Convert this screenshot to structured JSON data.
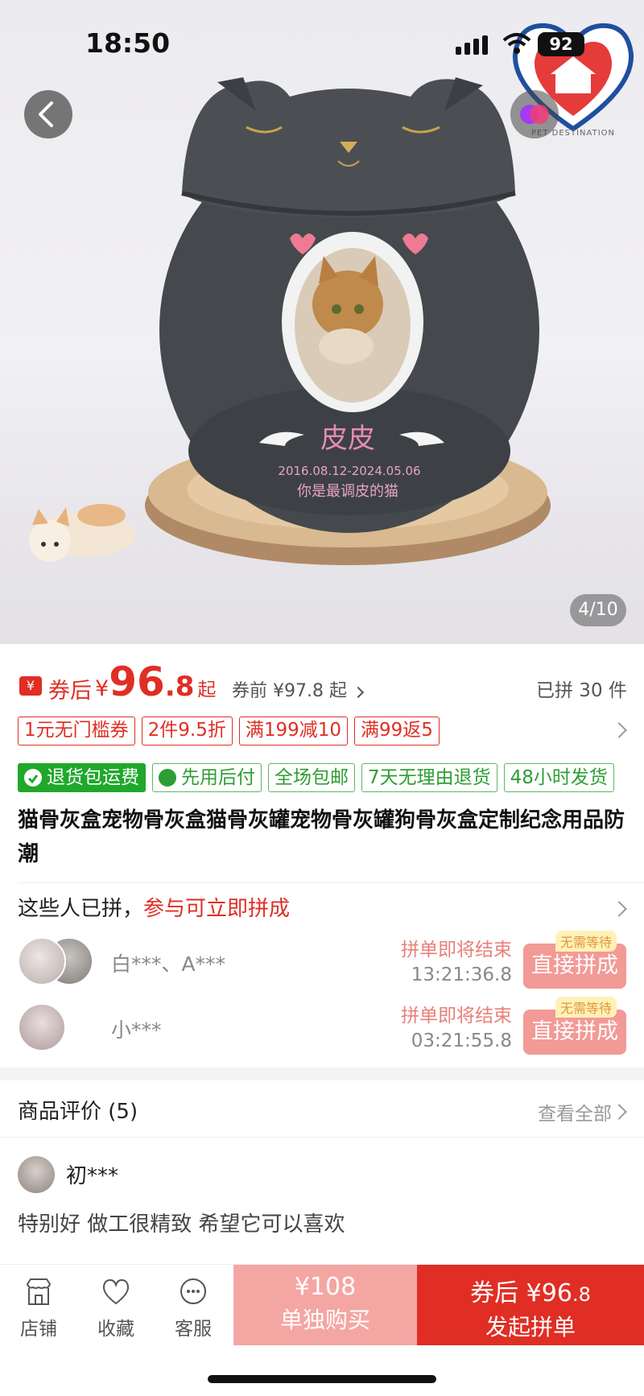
{
  "status_bar": {
    "time": "18:50",
    "battery": "92"
  },
  "hero": {
    "brand_text": "PET DESTINATION",
    "image_counter": "4/10",
    "urn_name": "皮皮",
    "urn_dates": "2016.08.12-2024.05.06",
    "urn_message": "你是最调皮的猫"
  },
  "price": {
    "after_label": "券后",
    "currency": "¥",
    "integer": "96",
    "decimal": ".8",
    "suffix": "起",
    "before_price": "券前 ¥97.8 起",
    "joined": "已拼 30 件"
  },
  "coupons": [
    "1元无门槛券",
    "2件9.5折",
    "满199减10",
    "满99返5"
  ],
  "services": [
    "退货包运费",
    "先用后付",
    "全场包邮",
    "7天无理由退货",
    "48小时发货"
  ],
  "product_title": "猫骨灰盒宠物骨灰盒猫骨灰罐宠物骨灰罐狗骨灰盒定制纪念用品防潮",
  "group_buy": {
    "heading": "这些人已拼，",
    "heading_highlight": "参与可立即拼成",
    "rows": [
      {
        "names": "白***、A***",
        "ending_label": "拼单即将结束",
        "time_left": "13:21:36.8",
        "badge": "无需等待",
        "button": "直接拼成"
      },
      {
        "names": "小***",
        "ending_label": "拼单即将结束",
        "time_left": "03:21:55.8",
        "badge": "无需等待",
        "button": "直接拼成"
      }
    ]
  },
  "reviews": {
    "heading": "商品评价 (5)",
    "see_all": "查看全部",
    "first": {
      "user": "初***",
      "text": "特别好 做工很精致  希望它可以喜欢"
    }
  },
  "bottom_bar": {
    "tabs": [
      {
        "label": "店铺",
        "icon": "store-icon"
      },
      {
        "label": "收藏",
        "icon": "heart-icon"
      },
      {
        "label": "客服",
        "icon": "chat-icon"
      }
    ],
    "single_price": "¥108",
    "single_label": "单独购买",
    "group_price_prefix": "券后 ¥96",
    "group_price_decimal": ".8",
    "group_label": "发起拼单"
  },
  "colors": {
    "accent": "#e02e24",
    "service_green": "#1fa82a",
    "single_buy": "#f4a6a3"
  }
}
